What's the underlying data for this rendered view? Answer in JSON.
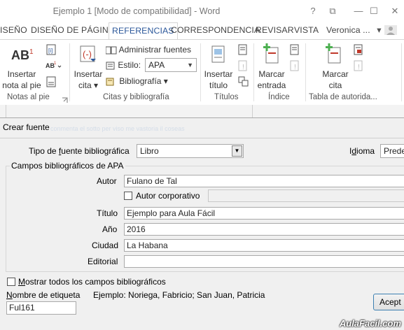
{
  "window": {
    "title": "Ejemplo 1 [Modo de compatibilidad] - Word",
    "help": "?",
    "restore_ribbon": "⧉",
    "minimize": "—",
    "maximize": "☐",
    "close": "✕"
  },
  "tabs": [
    {
      "label": "ISEÑO"
    },
    {
      "label": "DISEÑO DE PÁGINA"
    },
    {
      "label": "REFERENCIAS",
      "active": true
    },
    {
      "label": "CORRESPONDENCIA"
    },
    {
      "label": "REVISAR"
    },
    {
      "label": "VISTA"
    }
  ],
  "user": {
    "name": "Veronica ...",
    "dropdown": "▾"
  },
  "ribbon": {
    "notas": {
      "group_label": "Notas al pie",
      "insert_footnote_line1": "Insertar",
      "insert_footnote_line2": "nota al pie",
      "ab_text": "AB",
      "ab_sup": "1"
    },
    "citas": {
      "group_label": "Citas y bibliografía",
      "insert_citation_line1": "Insertar",
      "insert_citation_line2": "cita ▾",
      "manage_sources": "Administrar fuentes",
      "style_label": "Estilo:",
      "style_value": "APA",
      "bibliography": "Bibliografía ▾"
    },
    "titulos": {
      "group_label": "Títulos",
      "insert_caption_line1": "Insertar",
      "insert_caption_line2": "título"
    },
    "indice": {
      "group_label": "Índice",
      "mark_entry_line1": "Marcar",
      "mark_entry_line2": "entrada"
    },
    "autoridades": {
      "group_label": "Tabla de autorida...",
      "mark_citation_line1": "Marcar",
      "mark_citation_line2": "cita"
    }
  },
  "dialog": {
    "title": "Crear fuente",
    "title_ghost": "conmenta el sotto per viso me vastoria il coseas",
    "source_type_label_pre": "Tipo de ",
    "source_type_label_u": "f",
    "source_type_label_post": "uente bibliográfica",
    "source_type_value": "Libro",
    "language_label_pre": "I",
    "language_label_u": "d",
    "language_label_post": "ioma",
    "language_value": "Prede",
    "group_title": "Campos bibliográficos de APA",
    "fields": {
      "author_label": "Autor",
      "author_value": "Fulano de Tal",
      "corporate_author_label": "Autor corporativo",
      "title_label": "Título",
      "title_value": "Ejemplo para Aula Fácil",
      "year_label": "Año",
      "year_value": "2016",
      "city_label": "Ciudad",
      "city_value": "La Habana",
      "publisher_label": "Editorial",
      "publisher_value": ""
    },
    "show_all_pre": "",
    "show_all_u": "M",
    "show_all_post": "ostrar todos los campos bibliográficos",
    "tag_name_label_pre": "",
    "tag_name_label_u": "N",
    "tag_name_label_post": "ombre de etiqueta",
    "tag_name_value": "Ful161",
    "example_text": "Ejemplo: Noriega, Fabricio; San Juan, Patricia",
    "accept_label": "Acept"
  },
  "watermark": "AulaFacil.com",
  "colors": {
    "accent": "#2b579a",
    "button_border": "#3c7fb1",
    "dialog_bg": "#f0f0f0"
  }
}
